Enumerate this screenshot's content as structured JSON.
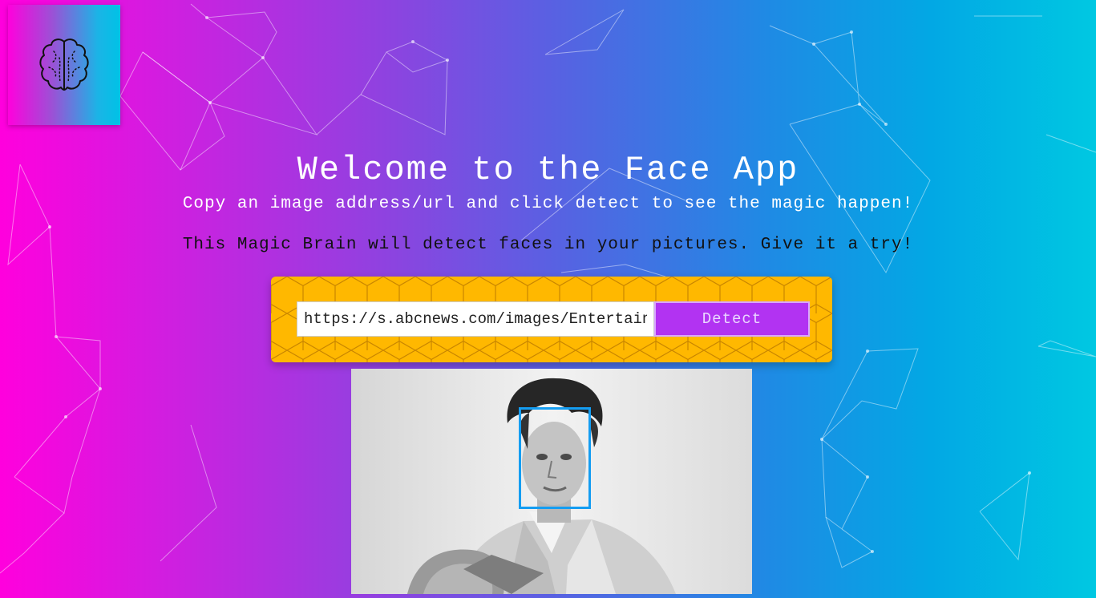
{
  "app": {
    "logo_icon": "brain-icon",
    "title": "Welcome to the Face App",
    "subtitle": "Copy an image address/url and click detect to see the magic happen!",
    "tagline": "This Magic Brain will detect faces in your pictures. Give it a try!"
  },
  "form": {
    "url_value": "https://s.abcnews.com/images/Entertainment/elvis-presley.jpg",
    "detect_label": "Detect"
  },
  "colors": {
    "gradient_start": "#ff00dd",
    "gradient_end": "#00c8e2",
    "panel": "#ffb800",
    "button": "#b233f2",
    "face_box": "#149df2"
  }
}
